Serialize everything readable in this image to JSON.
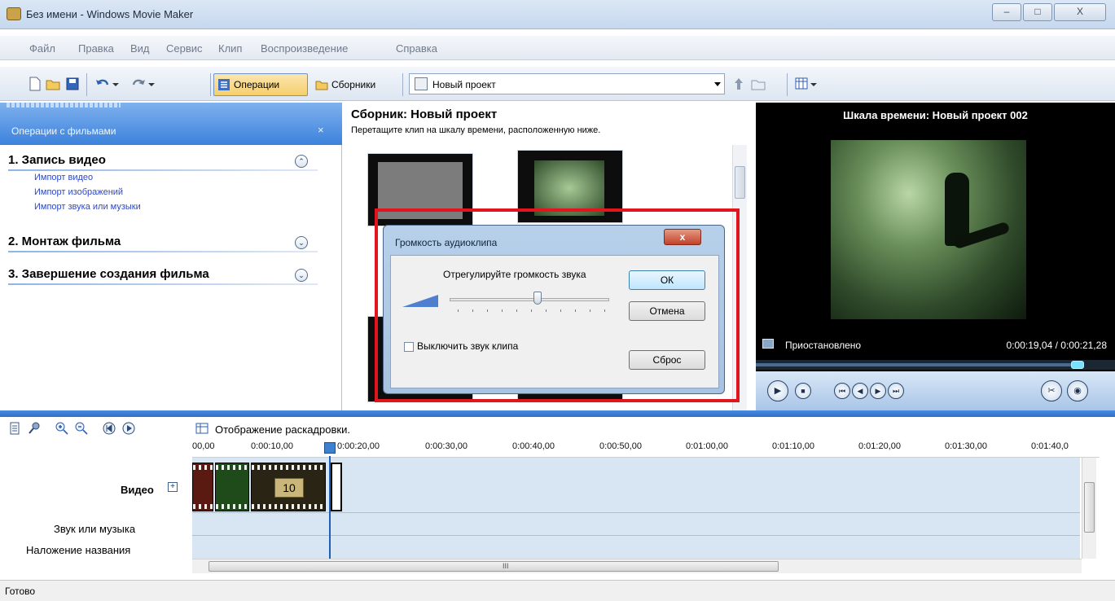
{
  "window": {
    "title": "Без имени - Windows Movie Maker",
    "controls": {
      "minimize": "‒",
      "maximize": "□",
      "close": "X"
    }
  },
  "menu": [
    "Файл",
    "Правка",
    "Вид",
    "Сервис",
    "Клип",
    "Воспроизведение",
    "Справка"
  ],
  "toolbar": {
    "operations_label": "Операции",
    "collections_label": "Сборники",
    "collection_combo": "Новый проект"
  },
  "tasks": {
    "header": "Операции с фильмами",
    "close": "×",
    "sections": [
      {
        "title": "1. Запись видео",
        "links": [
          "Импорт видео",
          "Импорт изображений",
          "Импорт звука или музыки"
        ],
        "chevron": "⌃"
      },
      {
        "title": "2. Монтаж фильма",
        "chevron": "⌄"
      },
      {
        "title": "3. Завершение создания фильма",
        "chevron": "⌄"
      }
    ]
  },
  "collection": {
    "title": "Сборник: Новый проект",
    "subtitle": "Перетащите клип на шкалу времени, расположенную ниже."
  },
  "dialog": {
    "title": "Громкость аудиоклипа",
    "close": "x",
    "instruction": "Отрегулируйте громкость звука",
    "volume_level": 0.55,
    "mute_label": "Выключить звук клипа",
    "mute_checked": false,
    "ok": "ОК",
    "cancel": "Отмена",
    "reset": "Сброс"
  },
  "preview": {
    "title": "Шкала времени: Новый проект 002",
    "status": "Приостановлено",
    "time": "0:00:19,04 / 0:00:21,28",
    "progress": 0.895
  },
  "timeline": {
    "storyboard_label": "Отображение раскадровки.",
    "ruler": [
      "00,00",
      "0:00:10,00",
      "0:00:20,00",
      "0:00:30,00",
      "0:00:40,00",
      "0:00:50,00",
      "0:01:00,00",
      "0:01:10,00",
      "0:01:20,00",
      "0:01:30,00",
      "0:01:40,0"
    ],
    "tracks": {
      "video": "Видео",
      "expand": "+",
      "audio": "Звук или музыка",
      "title_overlay": "Наложение названия"
    },
    "clip_countdown": "10",
    "scroll_grip": "III"
  },
  "status_bar": "Готово",
  "colors": {
    "accent": "#3c82dc",
    "highlight": "#e0161c",
    "track_bg": "#d8e6f4"
  }
}
